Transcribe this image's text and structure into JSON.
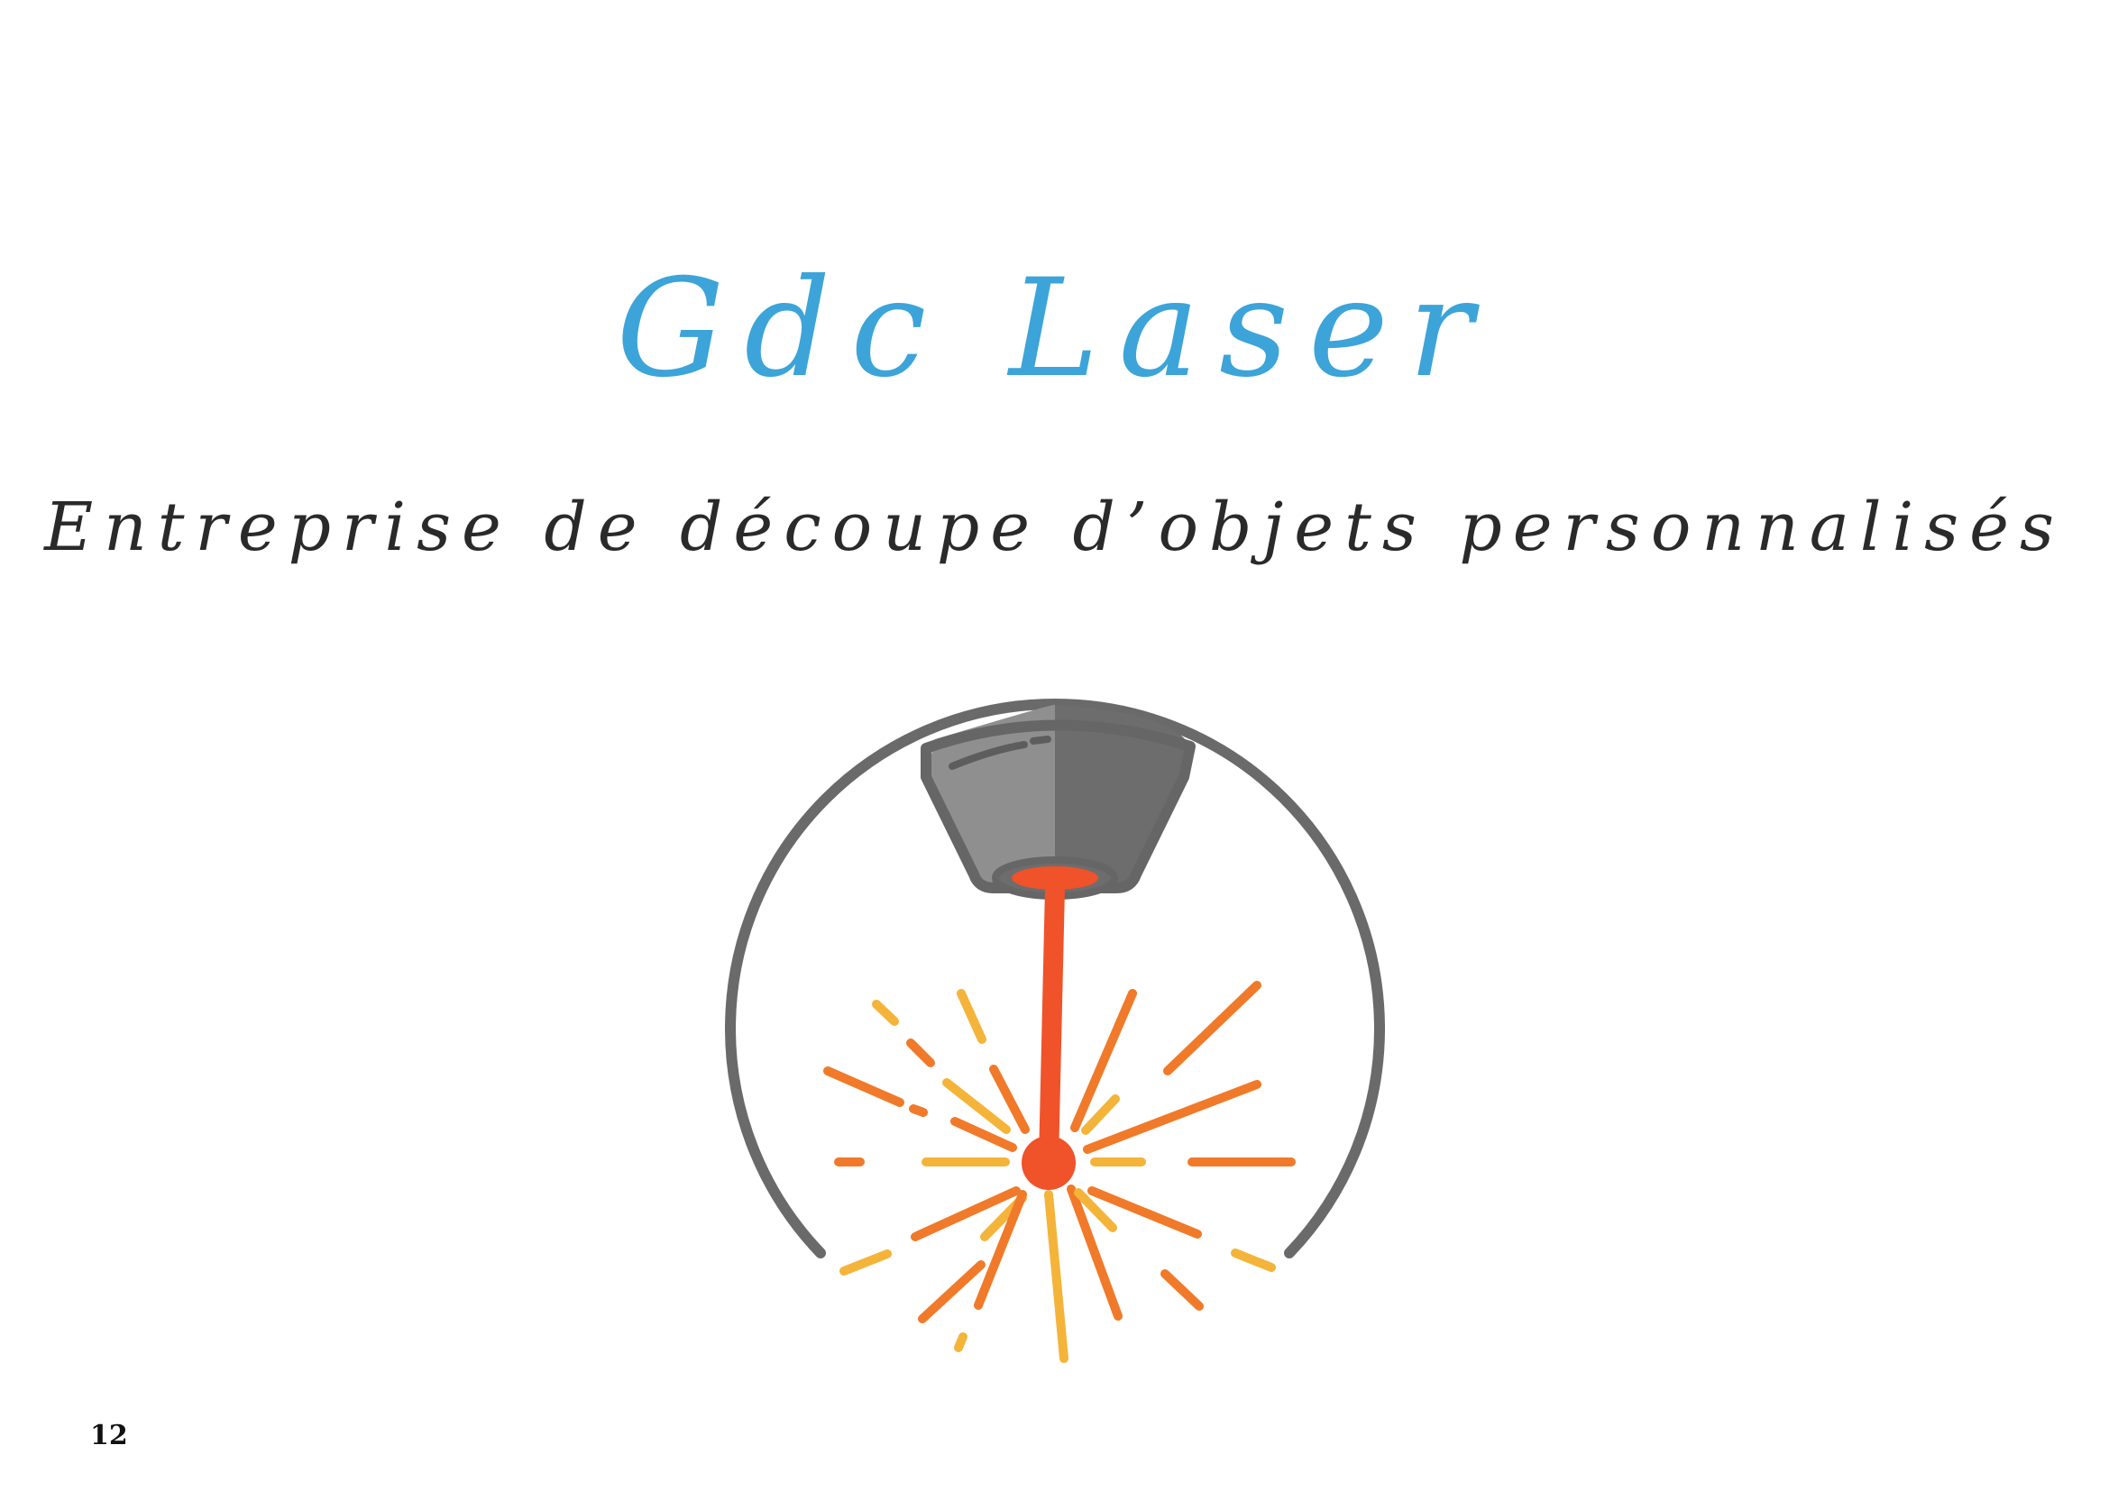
{
  "document": {
    "title": "Gdc Laser",
    "subtitle": "Entreprise de découpe d’objets personnalisés",
    "page_number": "12"
  },
  "logo": {
    "icon": "laser-cutter-icon",
    "colors": {
      "ring": "#6a6a6a",
      "head_light": "#8f8f8f",
      "head_dark": "#6d6d6d",
      "beam": "#f0522a",
      "spark_orange": "#f07a2a",
      "spark_yellow": "#f4b43a"
    }
  },
  "colors": {
    "title": "#3ca4d8",
    "subtitle": "#2a2a2a",
    "page_number": "#111111"
  }
}
